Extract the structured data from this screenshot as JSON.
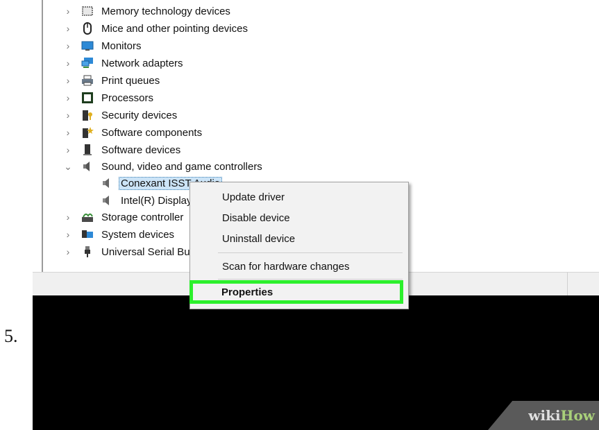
{
  "step_number": "5.",
  "tree": {
    "items": [
      {
        "label": "Memory technology devices",
        "expanded": false,
        "icon": "memory-icon"
      },
      {
        "label": "Mice and other pointing devices",
        "expanded": false,
        "icon": "mouse-icon"
      },
      {
        "label": "Monitors",
        "expanded": false,
        "icon": "monitor-icon"
      },
      {
        "label": "Network adapters",
        "expanded": false,
        "icon": "network-icon"
      },
      {
        "label": "Print queues",
        "expanded": false,
        "icon": "printer-icon"
      },
      {
        "label": "Processors",
        "expanded": false,
        "icon": "processor-icon"
      },
      {
        "label": "Security devices",
        "expanded": false,
        "icon": "security-icon"
      },
      {
        "label": "Software components",
        "expanded": false,
        "icon": "software-component-icon"
      },
      {
        "label": "Software devices",
        "expanded": false,
        "icon": "software-device-icon"
      },
      {
        "label": "Sound, video and game controllers",
        "expanded": true,
        "icon": "speaker-icon"
      }
    ],
    "children": [
      {
        "label": "Conexant ISST Audio",
        "selected": true,
        "icon": "speaker-icon"
      },
      {
        "label": "Intel(R) Display",
        "selected": false,
        "icon": "speaker-icon"
      }
    ],
    "after_items": [
      {
        "label": "Storage controller",
        "expanded": false,
        "icon": "storage-icon"
      },
      {
        "label": "System devices",
        "expanded": false,
        "icon": "system-icon"
      },
      {
        "label": "Universal Serial Bu",
        "expanded": false,
        "icon": "usb-icon"
      }
    ]
  },
  "context_menu": {
    "items": [
      "Update driver",
      "Disable device",
      "Uninstall device",
      "Scan for hardware changes",
      "Properties"
    ]
  },
  "watermark": {
    "part1": "wiki",
    "part2": "How"
  },
  "colors": {
    "highlight": "#2cf02c",
    "selection": "#cce4f7",
    "watermark_green": "#a9d07a"
  }
}
